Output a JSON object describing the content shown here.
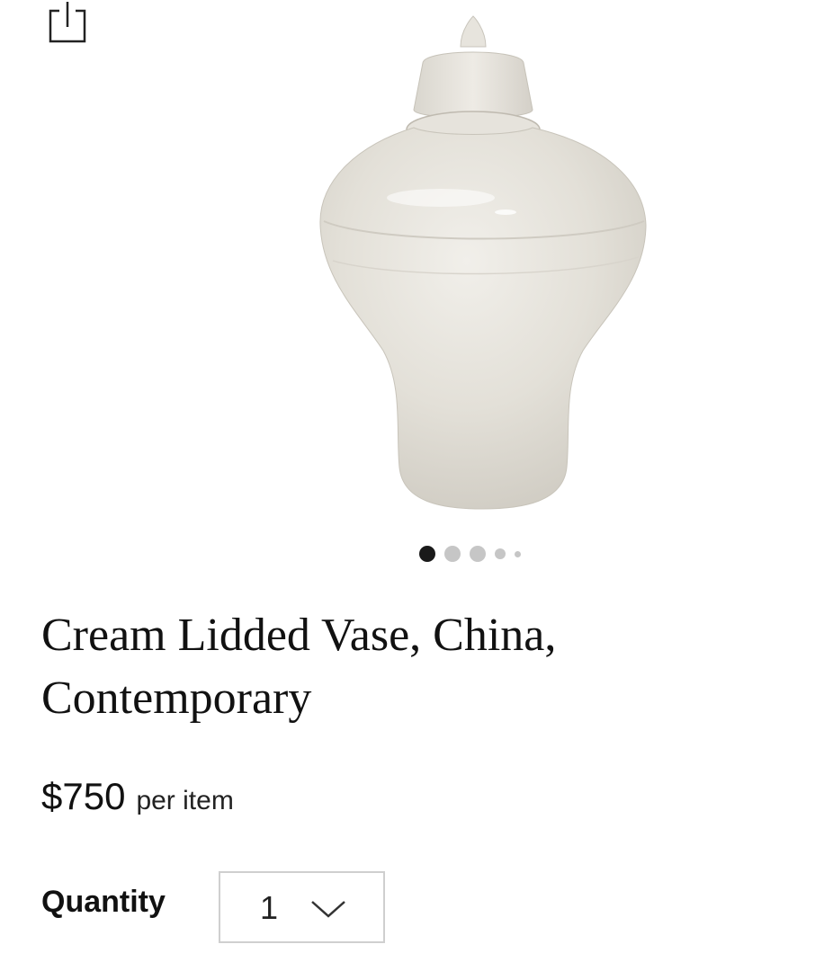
{
  "toolbar": {
    "share_icon": "share-icon"
  },
  "gallery": {
    "image_alt": "Cream Lidded Vase, China, Contemporary",
    "dots_total": 5,
    "active_index": 0
  },
  "product": {
    "title_line1": "Cream Lidded Vase, China,",
    "title_line2": "Contemporary",
    "price": "$750",
    "price_unit": "per item"
  },
  "quantity": {
    "label": "Quantity",
    "value": "1",
    "chevron_icon": "chevron-down-icon"
  },
  "colors": {
    "text": "#111111",
    "dot_active": "#1a1a1a",
    "dot_inactive": "#c6c6c6",
    "select_border": "#cfcfcf",
    "vase": "#e4e1da"
  }
}
